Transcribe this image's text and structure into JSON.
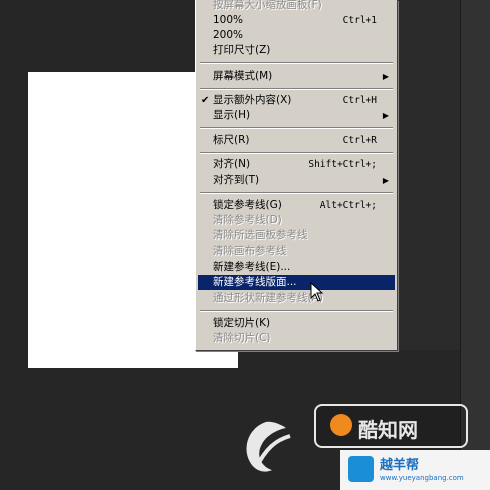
{
  "menu": {
    "items": [
      {
        "label": "按屏幕大小缩放画板(F)",
        "shortcut": "",
        "disabled": true
      },
      {
        "label": "100%",
        "shortcut": "Ctrl+1"
      },
      {
        "label": "200%",
        "shortcut": ""
      },
      {
        "label": "打印尺寸(Z)",
        "shortcut": ""
      },
      {
        "label": "屏幕模式(M)",
        "shortcut": "",
        "submenu": true
      },
      {
        "label": "显示额外内容(X)",
        "shortcut": "Ctrl+H",
        "checked": true
      },
      {
        "label": "显示(H)",
        "shortcut": "",
        "submenu": true
      },
      {
        "label": "标尺(R)",
        "shortcut": "Ctrl+R"
      },
      {
        "label": "对齐(N)",
        "shortcut": "Shift+Ctrl+;"
      },
      {
        "label": "对齐到(T)",
        "shortcut": "",
        "submenu": true
      },
      {
        "label": "锁定参考线(G)",
        "shortcut": "Alt+Ctrl+;"
      },
      {
        "label": "清除参考线(D)",
        "shortcut": "",
        "disabled": true
      },
      {
        "label": "清除所选画板参考线",
        "shortcut": "",
        "disabled": true
      },
      {
        "label": "清除画布参考线",
        "shortcut": "",
        "disabled": true
      },
      {
        "label": "新建参考线(E)...",
        "shortcut": ""
      },
      {
        "label": "新建参考线版面...",
        "shortcut": "",
        "highlighted": true
      },
      {
        "label": "通过形状新建参考线(A)",
        "shortcut": "",
        "disabled": true
      },
      {
        "label": "锁定切片(K)",
        "shortcut": ""
      },
      {
        "label": "清除切片(C)",
        "shortcut": "",
        "disabled": true
      }
    ],
    "check_glyph": "✔",
    "arrow_glyph": "▶"
  },
  "watermark": {
    "badge_text": "酷知网",
    "site_name": "越羊帮",
    "site_url": "www.yueyangbang.com"
  },
  "colors": {
    "menu_bg": "#d4d0c8",
    "highlight": "#0a246a",
    "workspace": "#262626"
  }
}
